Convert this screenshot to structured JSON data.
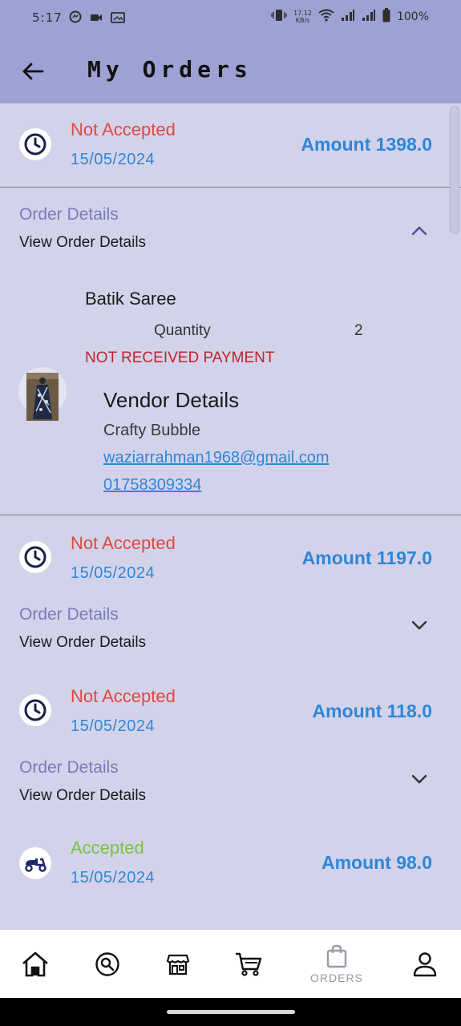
{
  "status_bar": {
    "time": "5:17",
    "net_speed_top": "17.12",
    "net_speed_bottom": "KB/s",
    "battery": "100%"
  },
  "app_bar": {
    "title": "My Orders"
  },
  "orders": [
    {
      "status": "Not Accepted",
      "status_color": "#e0483f",
      "date": "15/05/2024",
      "amount": "Amount 1398.0",
      "icon": "clock-icon",
      "details_title": "Order Details",
      "details_sub": "View Order Details",
      "expanded": true,
      "product_name": "Batik Saree",
      "quantity_label": "Quantity",
      "quantity_value": "2",
      "payment_status": "NOT RECEIVED PAYMENT",
      "vendor_title": "Vendor Details",
      "vendor_name": "Crafty Bubble",
      "vendor_email": "waziarrahman1968@gmail.com",
      "vendor_phone": "01758309334"
    },
    {
      "status": "Not Accepted",
      "status_color": "#e0483f",
      "date": "15/05/2024",
      "amount": "Amount 1197.0",
      "icon": "clock-icon",
      "details_title": "Order Details",
      "details_sub": "View Order Details",
      "expanded": false
    },
    {
      "status": "Not Accepted",
      "status_color": "#e0483f",
      "date": "15/05/2024",
      "amount": "Amount 118.0",
      "icon": "clock-icon",
      "details_title": "Order Details",
      "details_sub": "View Order Details",
      "expanded": false
    },
    {
      "status": "Accepted",
      "status_color": "#7cc04a",
      "date": "15/05/2024",
      "amount": "Amount 98.0",
      "icon": "scooter-icon"
    }
  ],
  "bottom_nav": {
    "items": [
      {
        "name": "home",
        "icon": "home-icon"
      },
      {
        "name": "search",
        "icon": "search-icon"
      },
      {
        "name": "store",
        "icon": "store-icon"
      },
      {
        "name": "cart",
        "icon": "cart-icon"
      },
      {
        "name": "orders",
        "icon": "shopping-bag-icon",
        "label": "ORDERS",
        "active": true
      },
      {
        "name": "profile",
        "icon": "person-icon"
      }
    ]
  },
  "colors": {
    "app_bar": "#9ea1d3",
    "background": "#d2d3ea",
    "accent_blue": "#2f86d6",
    "details_purple": "#7a7bbd",
    "payment_red": "#c0232b"
  }
}
